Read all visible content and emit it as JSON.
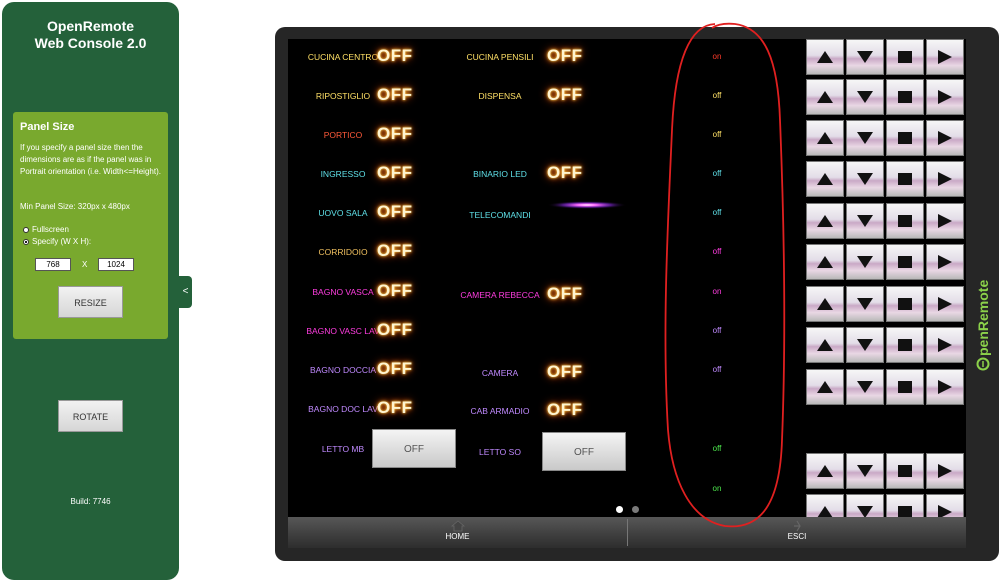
{
  "sidebar": {
    "title_line1": "OpenRemote",
    "title_line2": "Web Console 2.0",
    "panel_size": {
      "title": "Panel Size",
      "description": "If you specify a panel size then the dimensions are as if the panel was in Portrait orientation (i.e. Width<=Height).",
      "min_size": "Min Panel Size: 320px x 480px",
      "option_fullscreen": "Fullscreen",
      "option_specify": "Specify (W X H):",
      "width_value": "768",
      "x_label": "X",
      "height_value": "1024",
      "resize_label": "RESIZE"
    },
    "rotate_label": "ROTATE",
    "build": "Build: 7746",
    "collapse_glyph": "<"
  },
  "panel": {
    "col1": [
      {
        "label": "CUCINA CENTRO",
        "color": "#ffe066",
        "control": "OFF"
      },
      {
        "label": "RIPOSTIGLIO",
        "color": "#ffe066",
        "control": "OFF"
      },
      {
        "label": "PORTICO",
        "color": "#ff5a3a",
        "control": "OFF"
      },
      {
        "label": "INGRESSO",
        "color": "#5fe0e8",
        "control": "OFF"
      },
      {
        "label": "UOVO SALA",
        "color": "#5fe0e8",
        "control": "OFF"
      },
      {
        "label": "CORRIDOIO",
        "color": "#f0c060",
        "control": "OFF"
      },
      {
        "label": "BAGNO VASCA",
        "color": "#ff3de0",
        "control": "OFF"
      },
      {
        "label": "BAGNO VASC LAV",
        "color": "#ff3de0",
        "control": "OFF"
      },
      {
        "label": "BAGNO DOCCIA",
        "color": "#c08aff",
        "control": "OFF"
      },
      {
        "label": "BAGNO DOC LAV",
        "color": "#c08aff",
        "control": "OFF"
      },
      {
        "label": "LETTO MB",
        "color": "#c08aff",
        "control": "OFF"
      }
    ],
    "col2": [
      {
        "label": "CUCINA PENSILI",
        "color": "#ffe066",
        "control": "OFF"
      },
      {
        "label": "DISPENSA",
        "color": "#ffe066",
        "control": "OFF"
      },
      {
        "label": "BINARIO LED",
        "color": "#5fe0e8",
        "control": "OFF"
      },
      {
        "label": "TELECOMANDI",
        "color": "#5fe0e8",
        "control": ""
      },
      {
        "label": "CAMERA REBECCA",
        "color": "#ff3de0",
        "control": "OFF"
      },
      {
        "label": "CAMERA",
        "color": "#c08aff",
        "control": "OFF"
      },
      {
        "label": "CAB ARMADIO",
        "color": "#c08aff",
        "control": "OFF"
      },
      {
        "label": "LETTO SO",
        "color": "#c08aff",
        "control": "OFF"
      }
    ],
    "states": [
      {
        "value": "on",
        "color": "#ff3a2a"
      },
      {
        "value": "off",
        "color": "#ffe066"
      },
      {
        "value": "off",
        "color": "#ffe066"
      },
      {
        "value": "off",
        "color": "#5fe0e8"
      },
      {
        "value": "off",
        "color": "#5fe0e8"
      },
      {
        "value": "off",
        "color": "#ff3de0"
      },
      {
        "value": "on",
        "color": "#ff3de0"
      },
      {
        "value": "off",
        "color": "#c08aff"
      },
      {
        "value": "off",
        "color": "#c08aff"
      },
      {
        "value": "off",
        "color": "#4de84d"
      },
      {
        "value": "on",
        "color": "#4de84d"
      }
    ],
    "shutter_icons": [
      "up-triangle-icon",
      "down-triangle-icon",
      "stop-square-icon",
      "right-triangle-icon"
    ],
    "logo_text": "OpenRemote",
    "tabs": [
      {
        "label": "HOME",
        "icon": "home-icon"
      },
      {
        "label": "ESCI",
        "icon": "exit-icon"
      }
    ],
    "annotation_color": "#e02020"
  }
}
